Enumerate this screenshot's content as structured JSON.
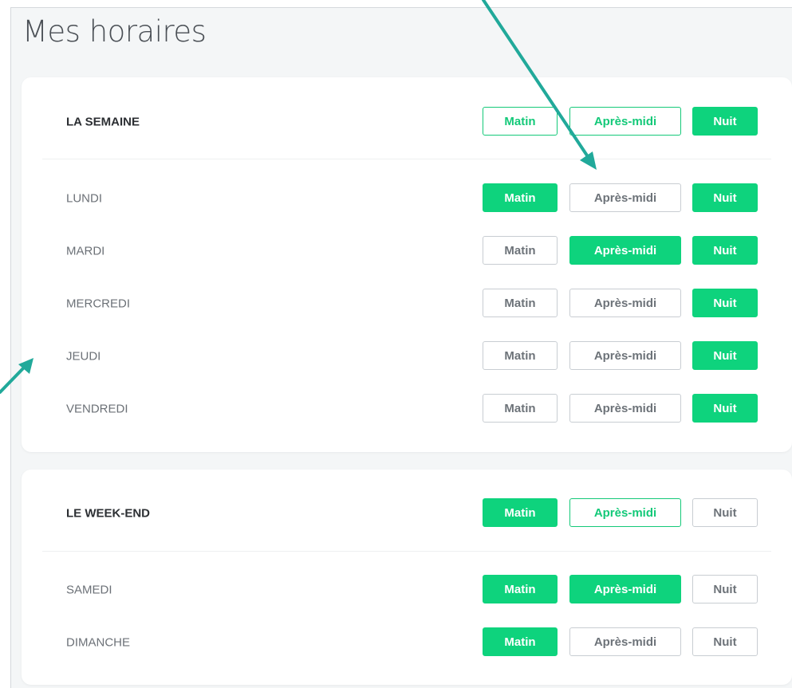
{
  "page_title": "Mes horaires",
  "labels": {
    "matin": "Matin",
    "apres_midi": "Après-midi",
    "nuit": "Nuit"
  },
  "colors": {
    "accent": "#0ed37d",
    "annotation_arrow": "#21a99a"
  },
  "week": {
    "header": {
      "label": "LA SEMAINE",
      "matin": "partial",
      "apres_midi": "partial",
      "nuit": "on"
    },
    "days": [
      {
        "label": "LUNDI",
        "matin": "on",
        "apres_midi": "off",
        "nuit": "on"
      },
      {
        "label": "MARDI",
        "matin": "off",
        "apres_midi": "on",
        "nuit": "on"
      },
      {
        "label": "MERCREDI",
        "matin": "off",
        "apres_midi": "off",
        "nuit": "on"
      },
      {
        "label": "JEUDI",
        "matin": "off",
        "apres_midi": "off",
        "nuit": "on"
      },
      {
        "label": "VENDREDI",
        "matin": "off",
        "apres_midi": "off",
        "nuit": "on"
      }
    ]
  },
  "weekend": {
    "header": {
      "label": "LE WEEK-END",
      "matin": "on",
      "apres_midi": "partial",
      "nuit": "off"
    },
    "days": [
      {
        "label": "SAMEDI",
        "matin": "on",
        "apres_midi": "on",
        "nuit": "off"
      },
      {
        "label": "DIMANCHE",
        "matin": "on",
        "apres_midi": "off",
        "nuit": "off"
      }
    ]
  }
}
